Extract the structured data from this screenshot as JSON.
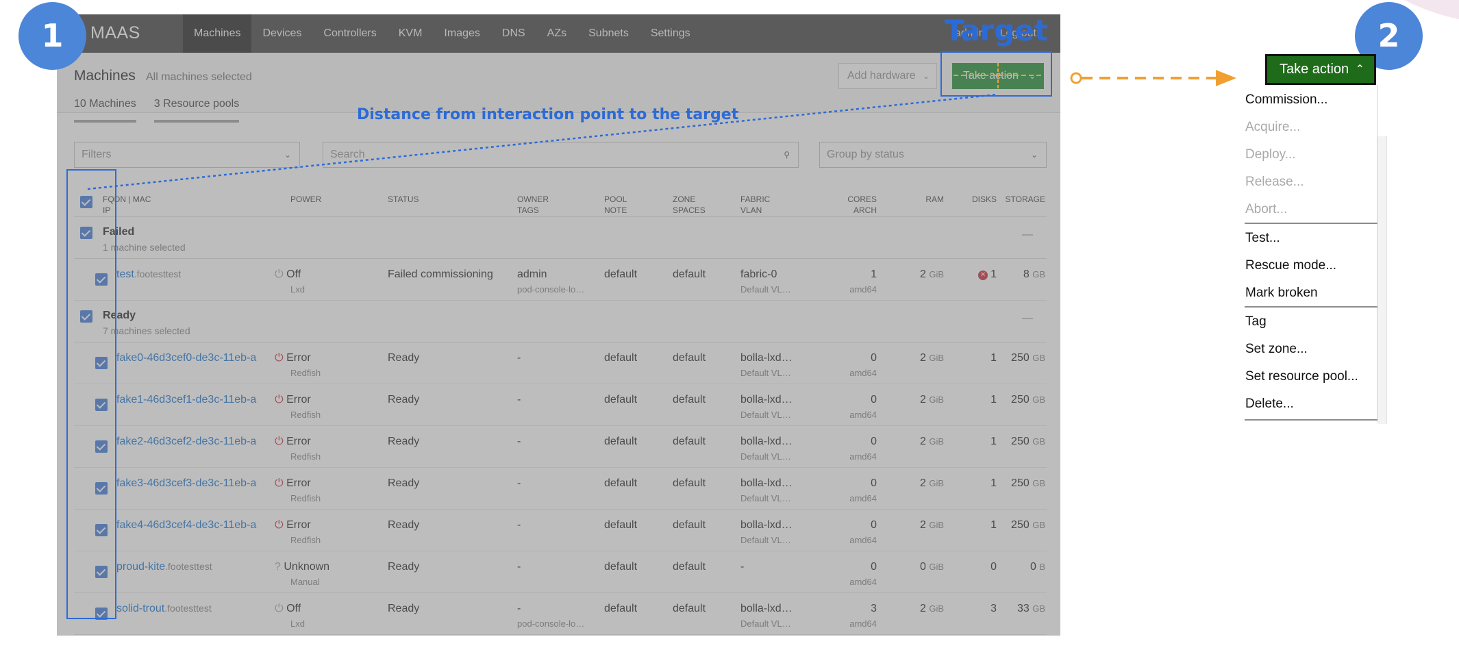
{
  "annotations": {
    "badge1": "1",
    "badge2": "2",
    "target_label": "Target",
    "distance_label": "Distance from interaction point to the target"
  },
  "navbar": {
    "logo": "MAAS",
    "items": [
      "Machines",
      "Devices",
      "Controllers",
      "KVM",
      "Images",
      "DNS",
      "AZs",
      "Subnets",
      "Settings"
    ],
    "right": [
      "admin",
      "Log out"
    ]
  },
  "header": {
    "title": "Machines",
    "subtitle": "All machines selected",
    "add_hardware": "Add hardware",
    "take_action": "Take action",
    "tabs": [
      "10 Machines",
      "3 Resource pools"
    ]
  },
  "filters": {
    "filters_label": "Filters",
    "search_placeholder": "Search",
    "group_by": "Group by status"
  },
  "columns": {
    "fqdn": "FQDN",
    "mac": "MAC",
    "ip": "IP",
    "power": "POWER",
    "status": "STATUS",
    "owner": "OWNER",
    "tags": "TAGS",
    "pool": "POOL",
    "note": "NOTE",
    "zone": "ZONE",
    "spaces": "SPACES",
    "fabric": "FABRIC",
    "vlan": "VLAN",
    "cores": "CORES",
    "arch": "ARCH",
    "ram": "RAM",
    "disks": "DISKS",
    "storage": "STORAGE"
  },
  "groups": [
    {
      "name": "Failed",
      "sub": "1 machine selected",
      "dash": "—"
    },
    {
      "name": "Ready",
      "sub": "7 machines selected",
      "dash": "—"
    }
  ],
  "rows": [
    {
      "host": "test",
      "domain": ".footesttest",
      "power": "Off",
      "power_type": "Lxd",
      "status": "Failed commissioning",
      "owner": "admin",
      "tags": "pod-console-lo…",
      "pool": "default",
      "zone": "default",
      "fabric": "fabric-0",
      "vlan": "Default VL…",
      "cores": "1",
      "arch": "amd64",
      "ram": "2",
      "ram_unit": "GiB",
      "disks": "1",
      "storage": "8",
      "storage_unit": "GB"
    },
    {
      "host": "fake0-46d3cef0-de3c-11eb-a",
      "domain": "",
      "power": "Error",
      "power_type": "Redfish",
      "status": "Ready",
      "owner": "-",
      "tags": "",
      "pool": "default",
      "zone": "default",
      "fabric": "bolla-lxd…",
      "vlan": "Default VL…",
      "cores": "0",
      "arch": "amd64",
      "ram": "2",
      "ram_unit": "GiB",
      "disks": "1",
      "storage": "250",
      "storage_unit": "GB"
    },
    {
      "host": "fake1-46d3cef1-de3c-11eb-a",
      "domain": "",
      "power": "Error",
      "power_type": "Redfish",
      "status": "Ready",
      "owner": "-",
      "tags": "",
      "pool": "default",
      "zone": "default",
      "fabric": "bolla-lxd…",
      "vlan": "Default VL…",
      "cores": "0",
      "arch": "amd64",
      "ram": "2",
      "ram_unit": "GiB",
      "disks": "1",
      "storage": "250",
      "storage_unit": "GB"
    },
    {
      "host": "fake2-46d3cef2-de3c-11eb-a",
      "domain": "",
      "power": "Error",
      "power_type": "Redfish",
      "status": "Ready",
      "owner": "-",
      "tags": "",
      "pool": "default",
      "zone": "default",
      "fabric": "bolla-lxd…",
      "vlan": "Default VL…",
      "cores": "0",
      "arch": "amd64",
      "ram": "2",
      "ram_unit": "GiB",
      "disks": "1",
      "storage": "250",
      "storage_unit": "GB"
    },
    {
      "host": "fake3-46d3cef3-de3c-11eb-a",
      "domain": "",
      "power": "Error",
      "power_type": "Redfish",
      "status": "Ready",
      "owner": "-",
      "tags": "",
      "pool": "default",
      "zone": "default",
      "fabric": "bolla-lxd…",
      "vlan": "Default VL…",
      "cores": "0",
      "arch": "amd64",
      "ram": "2",
      "ram_unit": "GiB",
      "disks": "1",
      "storage": "250",
      "storage_unit": "GB"
    },
    {
      "host": "fake4-46d3cef4-de3c-11eb-a",
      "domain": "",
      "power": "Error",
      "power_type": "Redfish",
      "status": "Ready",
      "owner": "-",
      "tags": "",
      "pool": "default",
      "zone": "default",
      "fabric": "bolla-lxd…",
      "vlan": "Default VL…",
      "cores": "0",
      "arch": "amd64",
      "ram": "2",
      "ram_unit": "GiB",
      "disks": "1",
      "storage": "250",
      "storage_unit": "GB"
    },
    {
      "host": "proud-kite",
      "domain": ".footesttest",
      "power": "Unknown",
      "power_type": "Manual",
      "status": "Ready",
      "owner": "-",
      "tags": "",
      "pool": "default",
      "zone": "default",
      "fabric": "-",
      "vlan": "",
      "cores": "0",
      "arch": "amd64",
      "ram": "0",
      "ram_unit": "GiB",
      "disks": "0",
      "storage": "0",
      "storage_unit": "B"
    },
    {
      "host": "solid-trout",
      "domain": ".footesttest",
      "power": "Off",
      "power_type": "Lxd",
      "status": "Ready",
      "owner": "-",
      "tags": "pod-console-lo…",
      "pool": "default",
      "zone": "default",
      "fabric": "bolla-lxd…",
      "vlan": "Default VL…",
      "cores": "3",
      "arch": "amd64",
      "ram": "2",
      "ram_unit": "GiB",
      "disks": "3",
      "storage": "33",
      "storage_unit": "GB"
    }
  ],
  "dropdown": {
    "button": "Take action",
    "items": [
      {
        "label": "Commission...",
        "disabled": false
      },
      {
        "label": "Acquire...",
        "disabled": true
      },
      {
        "label": "Deploy...",
        "disabled": true
      },
      {
        "label": "Release...",
        "disabled": true
      },
      {
        "label": "Abort...",
        "disabled": true
      },
      {
        "label": "Test...",
        "disabled": false
      },
      {
        "label": "Rescue mode...",
        "disabled": false
      },
      {
        "label": "Mark broken",
        "disabled": false
      },
      {
        "label": "Tag",
        "disabled": false
      },
      {
        "label": "Set zone...",
        "disabled": false
      },
      {
        "label": "Set resource pool...",
        "disabled": false
      },
      {
        "label": "Delete...",
        "disabled": false
      }
    ]
  },
  "colors": {
    "annotation_blue": "#2c6bd6",
    "badge_blue": "#4c86d8",
    "arrow_orange": "#f0a030",
    "take_action_green": "#0e8420",
    "checkbox_blue": "#2f6fd6"
  }
}
